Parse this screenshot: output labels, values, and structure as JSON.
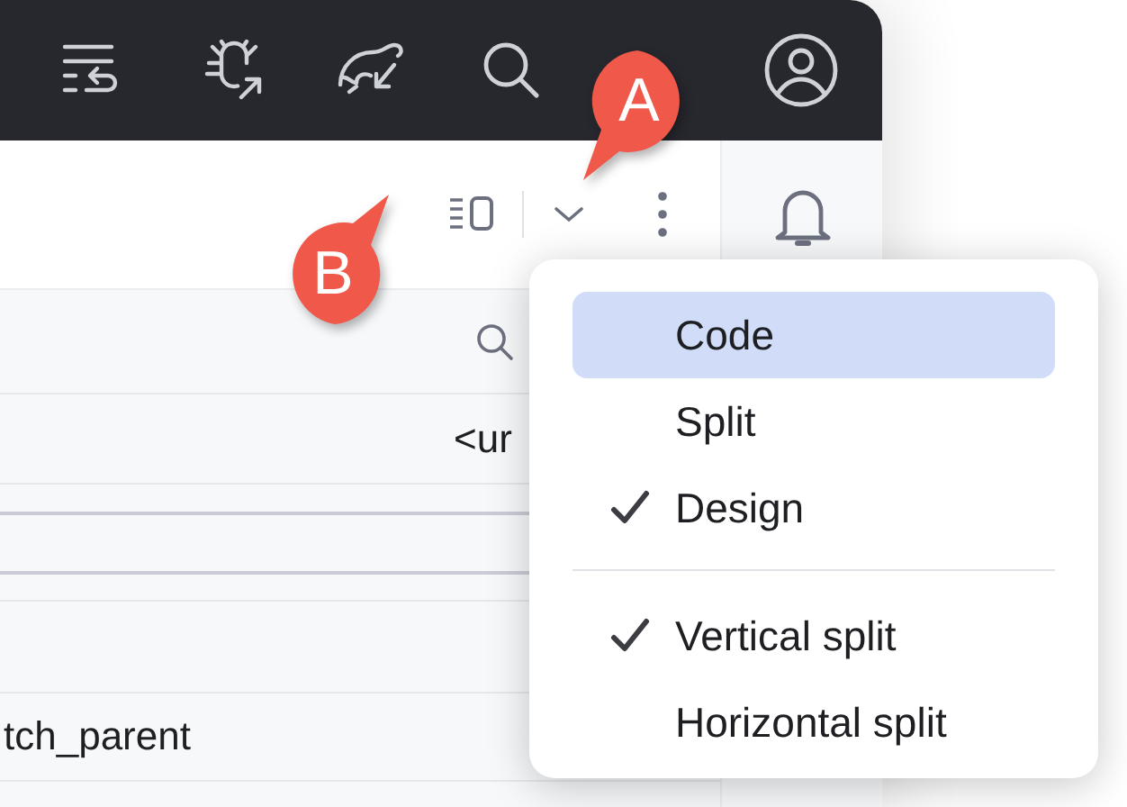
{
  "top_toolbar": {
    "icons": [
      {
        "kind": "commit-list"
      },
      {
        "kind": "bug"
      },
      {
        "kind": "elephant"
      },
      {
        "kind": "search"
      },
      {
        "kind": "profile"
      }
    ]
  },
  "editor_toolbar": {
    "buttons": [
      {
        "kind": "split-view"
      },
      {
        "kind": "chevron"
      },
      {
        "kind": "more"
      }
    ]
  },
  "attributes_panel": {
    "rows": [
      {
        "kind": "search"
      },
      {
        "kind": "value",
        "value": "<ur"
      },
      {
        "kind": "group"
      },
      {
        "kind": "group"
      },
      {
        "kind": "plain"
      },
      {
        "kind": "plain"
      },
      {
        "kind": "text",
        "value": "tch_parent"
      },
      {
        "kind": "plain"
      }
    ]
  },
  "view_menu": {
    "sections": [
      [
        {
          "label": "Code",
          "selected": true,
          "checked": false
        },
        {
          "label": "Split",
          "selected": false,
          "checked": false
        },
        {
          "label": "Design",
          "selected": false,
          "checked": true
        }
      ],
      [
        {
          "label": "Vertical split",
          "selected": false,
          "checked": true
        },
        {
          "label": "Horizontal split",
          "selected": false,
          "checked": false
        }
      ]
    ]
  },
  "callouts": [
    {
      "label": "A",
      "kind": "down-left"
    },
    {
      "label": "B",
      "kind": "up-right"
    }
  ]
}
